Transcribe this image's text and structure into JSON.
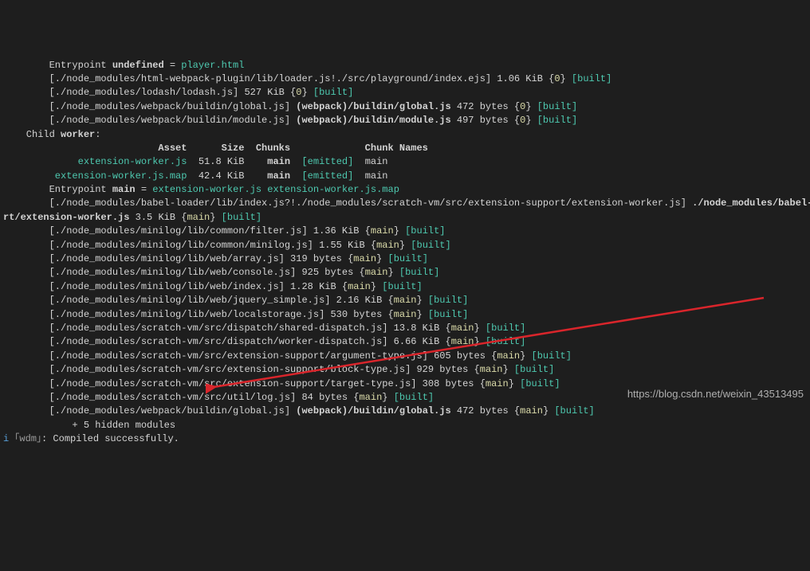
{
  "lines": [
    [
      {
        "cls": "w",
        "t": "        Entrypoint "
      },
      {
        "cls": "wb w",
        "t": "undefined"
      },
      {
        "cls": "w",
        "t": " = "
      },
      {
        "cls": "g",
        "t": "player.html"
      }
    ],
    [
      {
        "cls": "w",
        "t": "        [./node_modules/html-webpack-plugin/lib/loader.js!./src/playground/index.ejs] 1.06 KiB {"
      },
      {
        "cls": "y",
        "t": "0"
      },
      {
        "cls": "w",
        "t": "} "
      },
      {
        "cls": "g",
        "t": "[built]"
      }
    ],
    [
      {
        "cls": "w",
        "t": "        [./node_modules/lodash/lodash.js] 527 KiB {"
      },
      {
        "cls": "y",
        "t": "0"
      },
      {
        "cls": "w",
        "t": "} "
      },
      {
        "cls": "g",
        "t": "[built]"
      }
    ],
    [
      {
        "cls": "w",
        "t": "        [./node_modules/webpack/buildin/global.js] "
      },
      {
        "cls": "wb w",
        "t": "(webpack)/buildin/global.js"
      },
      {
        "cls": "w",
        "t": " 472 bytes {"
      },
      {
        "cls": "y",
        "t": "0"
      },
      {
        "cls": "w",
        "t": "} "
      },
      {
        "cls": "g",
        "t": "[built]"
      }
    ],
    [
      {
        "cls": "w",
        "t": "        [./node_modules/webpack/buildin/module.js] "
      },
      {
        "cls": "wb w",
        "t": "(webpack)/buildin/module.js"
      },
      {
        "cls": "w",
        "t": " 497 bytes {"
      },
      {
        "cls": "y",
        "t": "0"
      },
      {
        "cls": "w",
        "t": "} "
      },
      {
        "cls": "g",
        "t": "[built]"
      }
    ],
    [
      {
        "cls": "w",
        "t": "    Child "
      },
      {
        "cls": "wb w",
        "t": "worker"
      },
      {
        "cls": "w",
        "t": ":"
      }
    ],
    [
      {
        "cls": "wb w",
        "t": "                           Asset      Size  Chunks             Chunk Names"
      }
    ],
    [
      {
        "cls": "g",
        "t": "             extension-worker.js"
      },
      {
        "cls": "w",
        "t": "  51.8 KiB    "
      },
      {
        "cls": "wb w",
        "t": "main"
      },
      {
        "cls": "w",
        "t": "  "
      },
      {
        "cls": "g",
        "t": "[emitted]"
      },
      {
        "cls": "w",
        "t": "  main"
      }
    ],
    [
      {
        "cls": "g",
        "t": "         extension-worker.js.map"
      },
      {
        "cls": "w",
        "t": "  42.4 KiB    "
      },
      {
        "cls": "wb w",
        "t": "main"
      },
      {
        "cls": "w",
        "t": "  "
      },
      {
        "cls": "g",
        "t": "[emitted]"
      },
      {
        "cls": "w",
        "t": "  main"
      }
    ],
    [
      {
        "cls": "w",
        "t": "        Entrypoint "
      },
      {
        "cls": "wb w",
        "t": "main"
      },
      {
        "cls": "w",
        "t": " = "
      },
      {
        "cls": "g",
        "t": "extension-worker.js"
      },
      {
        "cls": "w",
        "t": " "
      },
      {
        "cls": "g",
        "t": "extension-worker.js.map"
      }
    ],
    [
      {
        "cls": "w",
        "t": "        [./node_modules/babel-loader/lib/index.js?!./node_modules/scratch-vm/src/extension-support/extension-worker.js] "
      },
      {
        "cls": "wb w",
        "t": "./node_modules/babel-l"
      }
    ],
    [
      {
        "cls": "wb w",
        "t": "rt/extension-worker.js"
      },
      {
        "cls": "w",
        "t": " 3.5 KiB {"
      },
      {
        "cls": "y",
        "t": "main"
      },
      {
        "cls": "w",
        "t": "} "
      },
      {
        "cls": "g",
        "t": "[built]"
      }
    ],
    [
      {
        "cls": "w",
        "t": "        [./node_modules/minilog/lib/common/filter.js] 1.36 KiB {"
      },
      {
        "cls": "y",
        "t": "main"
      },
      {
        "cls": "w",
        "t": "} "
      },
      {
        "cls": "g",
        "t": "[built]"
      }
    ],
    [
      {
        "cls": "w",
        "t": "        [./node_modules/minilog/lib/common/minilog.js] 1.55 KiB {"
      },
      {
        "cls": "y",
        "t": "main"
      },
      {
        "cls": "w",
        "t": "} "
      },
      {
        "cls": "g",
        "t": "[built]"
      }
    ],
    [
      {
        "cls": "w",
        "t": "        [./node_modules/minilog/lib/web/array.js] 319 bytes {"
      },
      {
        "cls": "y",
        "t": "main"
      },
      {
        "cls": "w",
        "t": "} "
      },
      {
        "cls": "g",
        "t": "[built]"
      }
    ],
    [
      {
        "cls": "w",
        "t": "        [./node_modules/minilog/lib/web/console.js] 925 bytes {"
      },
      {
        "cls": "y",
        "t": "main"
      },
      {
        "cls": "w",
        "t": "} "
      },
      {
        "cls": "g",
        "t": "[built]"
      }
    ],
    [
      {
        "cls": "w",
        "t": "        [./node_modules/minilog/lib/web/index.js] 1.28 KiB {"
      },
      {
        "cls": "y",
        "t": "main"
      },
      {
        "cls": "w",
        "t": "} "
      },
      {
        "cls": "g",
        "t": "[built]"
      }
    ],
    [
      {
        "cls": "w",
        "t": "        [./node_modules/minilog/lib/web/jquery_simple.js] 2.16 KiB {"
      },
      {
        "cls": "y",
        "t": "main"
      },
      {
        "cls": "w",
        "t": "} "
      },
      {
        "cls": "g",
        "t": "[built]"
      }
    ],
    [
      {
        "cls": "w",
        "t": "        [./node_modules/minilog/lib/web/localstorage.js] 530 bytes {"
      },
      {
        "cls": "y",
        "t": "main"
      },
      {
        "cls": "w",
        "t": "} "
      },
      {
        "cls": "g",
        "t": "[built]"
      }
    ],
    [
      {
        "cls": "w",
        "t": "        [./node_modules/scratch-vm/src/dispatch/shared-dispatch.js] 13.8 KiB {"
      },
      {
        "cls": "y",
        "t": "main"
      },
      {
        "cls": "w",
        "t": "} "
      },
      {
        "cls": "g",
        "t": "[built]"
      }
    ],
    [
      {
        "cls": "w",
        "t": "        [./node_modules/scratch-vm/src/dispatch/worker-dispatch.js] 6.66 KiB {"
      },
      {
        "cls": "y",
        "t": "main"
      },
      {
        "cls": "w",
        "t": "} "
      },
      {
        "cls": "g",
        "t": "[built]"
      }
    ],
    [
      {
        "cls": "w",
        "t": "        [./node_modules/scratch-vm/src/extension-support/argument-type.js] 605 bytes {"
      },
      {
        "cls": "y",
        "t": "main"
      },
      {
        "cls": "w",
        "t": "} "
      },
      {
        "cls": "g",
        "t": "[built]"
      }
    ],
    [
      {
        "cls": "w",
        "t": "        [./node_modules/scratch-vm/src/extension-support/block-type.js] 929 bytes {"
      },
      {
        "cls": "y",
        "t": "main"
      },
      {
        "cls": "w",
        "t": "} "
      },
      {
        "cls": "g",
        "t": "[built]"
      }
    ],
    [
      {
        "cls": "w",
        "t": "        [./node_modules/scratch-vm/src/extension-support/target-type.js] 308 bytes {"
      },
      {
        "cls": "y",
        "t": "main"
      },
      {
        "cls": "w",
        "t": "} "
      },
      {
        "cls": "g",
        "t": "[built]"
      }
    ],
    [
      {
        "cls": "w",
        "t": "        [./node_modules/scratch-vm/src/util/log.js] 84 bytes {"
      },
      {
        "cls": "y",
        "t": "main"
      },
      {
        "cls": "w",
        "t": "} "
      },
      {
        "cls": "g",
        "t": "[built]"
      }
    ],
    [
      {
        "cls": "w",
        "t": "        [./node_modules/webpack/buildin/global.js] "
      },
      {
        "cls": "wb w",
        "t": "(webpack)/buildin/global.js"
      },
      {
        "cls": "w",
        "t": " 472 bytes {"
      },
      {
        "cls": "y",
        "t": "main"
      },
      {
        "cls": "w",
        "t": "} "
      },
      {
        "cls": "g",
        "t": "[built]"
      }
    ],
    [
      {
        "cls": "w",
        "t": "            + 5 hidden modules"
      }
    ],
    [
      {
        "cls": "bl",
        "t": "i"
      },
      {
        "cls": "gr",
        "t": " ｢wdm｣"
      },
      {
        "cls": "w",
        "t": ": Compiled successfully."
      }
    ]
  ],
  "watermark": "https://blog.csdn.net/weixin_43513495"
}
